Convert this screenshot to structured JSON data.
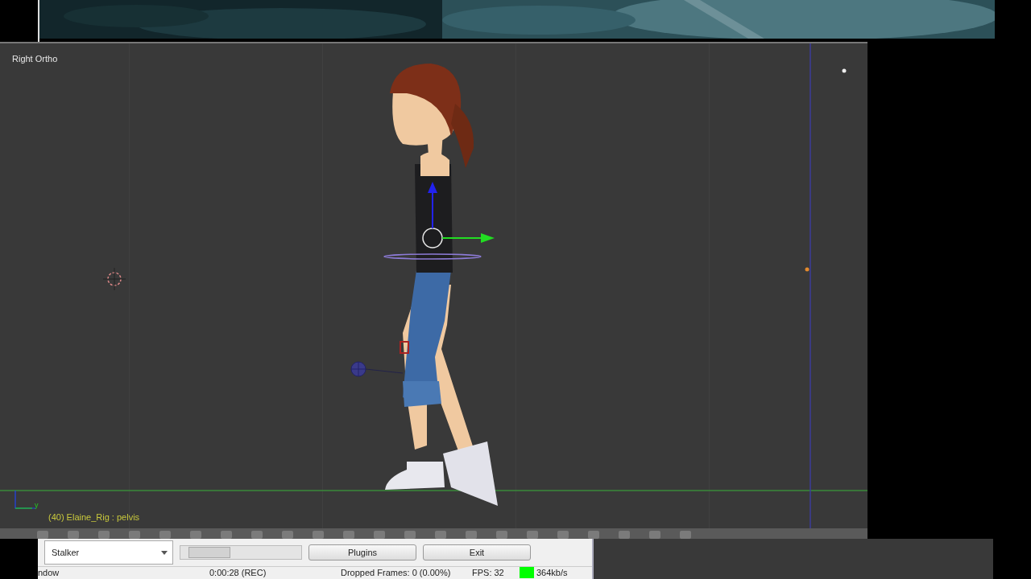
{
  "viewport": {
    "view_name": "Right Ortho",
    "status_text": "(40) Elaine_Rig : pelvis",
    "axis_label": "y"
  },
  "recorder": {
    "sources": [
      "Stalker"
    ],
    "buttons": [
      "Plugins",
      "Exit"
    ],
    "status": [
      "ndow",
      "0:00:28 (REC)",
      "Dropped Frames: 0 (0.00%)",
      "FPS: 32"
    ],
    "signal": {
      "color": "#00ff00",
      "reading": "364kb/s"
    }
  }
}
